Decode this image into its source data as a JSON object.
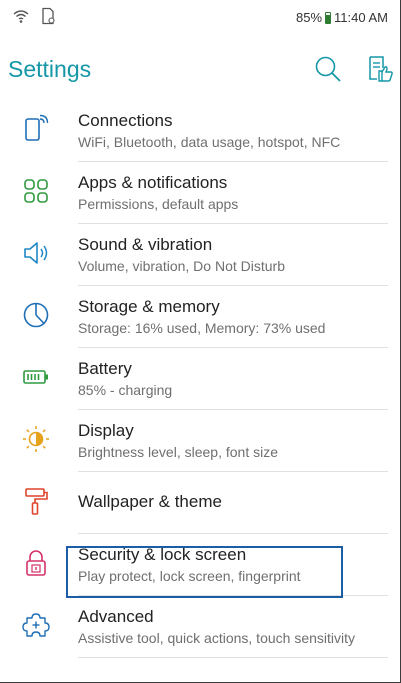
{
  "status_bar": {
    "battery_text": "85%",
    "time": "11:40 AM",
    "battery_color": "#2e7d32"
  },
  "header": {
    "title": "Settings",
    "title_color": "#1597a8",
    "icons": [
      "search-icon",
      "feedback-icon"
    ]
  },
  "items": [
    {
      "title": "Connections",
      "subtitle": "WiFi, Bluetooth, data usage, hotspot, NFC",
      "icon": "connections-icon",
      "color": "#1e6fb5"
    },
    {
      "title": "Apps & notifications",
      "subtitle": "Permissions, default apps",
      "icon": "apps-grid-icon",
      "color": "#2e9b3e"
    },
    {
      "title": "Sound & vibration",
      "subtitle": "Volume, vibration, Do Not Disturb",
      "icon": "speaker-icon",
      "color": "#1e88c7"
    },
    {
      "title": "Storage & memory",
      "subtitle": "Storage: 16% used, Memory: 73% used",
      "icon": "storage-pie-icon",
      "color": "#1e6fb5"
    },
    {
      "title": "Battery",
      "subtitle": "85% - charging",
      "icon": "battery-icon",
      "color": "#2e9b3e"
    },
    {
      "title": "Display",
      "subtitle": "Brightness level, sleep, font size",
      "icon": "brightness-icon",
      "color": "#e6a21a"
    },
    {
      "title": "Wallpaper & theme",
      "subtitle": "",
      "icon": "paint-roller-icon",
      "color": "#e0442c"
    },
    {
      "title": "Security & lock screen",
      "subtitle": "Play protect, lock screen, fingerprint",
      "icon": "lock-icon",
      "color": "#d6336c"
    },
    {
      "title": "Advanced",
      "subtitle": "Assistive tool, quick actions, touch sensitivity",
      "icon": "puzzle-icon",
      "color": "#1e6fb5"
    }
  ],
  "highlight_color": "#1c5ea6"
}
